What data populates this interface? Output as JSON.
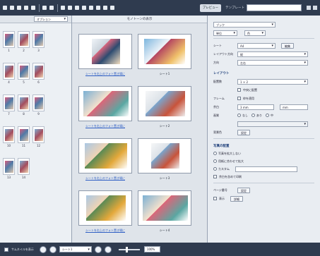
{
  "toolbar": {
    "preview_button": "プレビュー",
    "template_label": "テンプレート"
  },
  "left": {
    "option_label": "オプション"
  },
  "center": {
    "header_title": "モノトーンの表示",
    "spreads": [
      {
        "left_caption": "シートを右上のフォト置き場に",
        "right_caption": "シート1"
      },
      {
        "left_caption": "シートを右上のフォト置き場に",
        "right_caption": "シート2"
      },
      {
        "left_caption": "シートを右上のフォト置き場に",
        "right_caption": "シート3"
      },
      {
        "left_caption": "シートを右上のフォト置き場に",
        "right_caption": "シート4"
      }
    ]
  },
  "right": {
    "book_type": "ブック",
    "top_select_left": "単位",
    "top_select_right": "色",
    "sheet_label": "シート",
    "sheet_value": "A4",
    "sheet_edit": "編集",
    "layout_label": "レイアウト方向",
    "layout_value": "縦",
    "direction_label": "方向",
    "direction_value": "左右",
    "section_layout": "レイアウト",
    "grid_label": "配置数",
    "grid_value": "1 × 2",
    "check_center": "中央に配置",
    "frame_label": "フレーム",
    "frame_check": "枠を適用",
    "margin_label": "余白",
    "margin_value": "3 mm",
    "margin_unit": "mm",
    "quality_label": "画質",
    "quality_option_1": "なし",
    "quality_option_2": "あり",
    "quality_option_3": "中",
    "bgcolor_label": "背景色",
    "bgcolor_button": "設定",
    "section_fit": "写真の配置",
    "fit_option_1": "写真を拡大しない",
    "fit_option_2": "用紙に合わせて拡大",
    "fit_option_3": "カスタム",
    "check_print_margin": "余白を含めて印刷",
    "page_number_label": "ページ番号",
    "page_number_button": "設定",
    "bottom_check": "表示",
    "bottom_button": "詳細"
  },
  "statusbar": {
    "check_label": "サムネイルを表示",
    "page_select": "シート1",
    "zoom_value": "100%"
  }
}
